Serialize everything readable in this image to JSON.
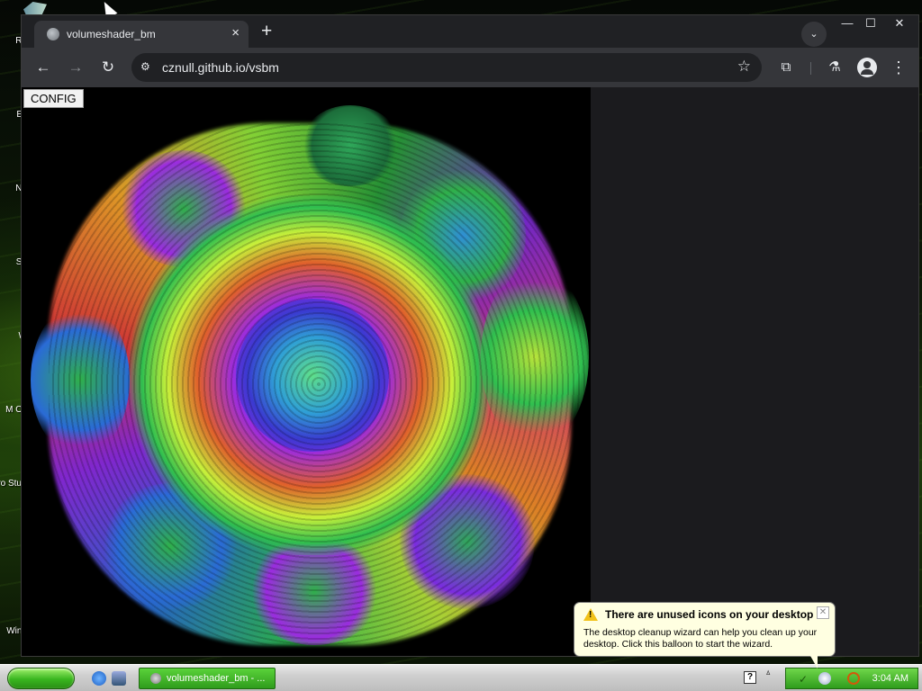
{
  "desktop": {
    "icon_labels": [
      "Re",
      "Ev",
      "No",
      "Su",
      "W",
      "M O",
      "Micro Stu",
      "Wind"
    ]
  },
  "browser": {
    "tab_title": "volumeshader_bm",
    "tab_close": "×",
    "new_tab": "+",
    "tab_search": "⌄",
    "window_controls": {
      "minimize": "—",
      "maximize": "☐",
      "close": "✕"
    },
    "nav": {
      "back": "←",
      "forward": "→",
      "reload": "↻"
    },
    "address": {
      "icon": "⚙",
      "url": "cznull.github.io/vsbm",
      "bookmark": "☆"
    },
    "toolbar_icons": {
      "extensions": "⧉",
      "labs": "⚗",
      "menu": "⋮"
    },
    "page": {
      "config_button": "CONFIG"
    }
  },
  "taskbar": {
    "task_button_label": "volumeshader_bm - ...",
    "help": "?",
    "tray_chevron": "ㅿ",
    "clock": "3:04 AM"
  },
  "balloon": {
    "title": "There are unused icons on your desktop",
    "body": "The desktop cleanup wizard can help you clean up your desktop. Click this balloon to start the wizard.",
    "close": "✕",
    "warn": "!"
  }
}
